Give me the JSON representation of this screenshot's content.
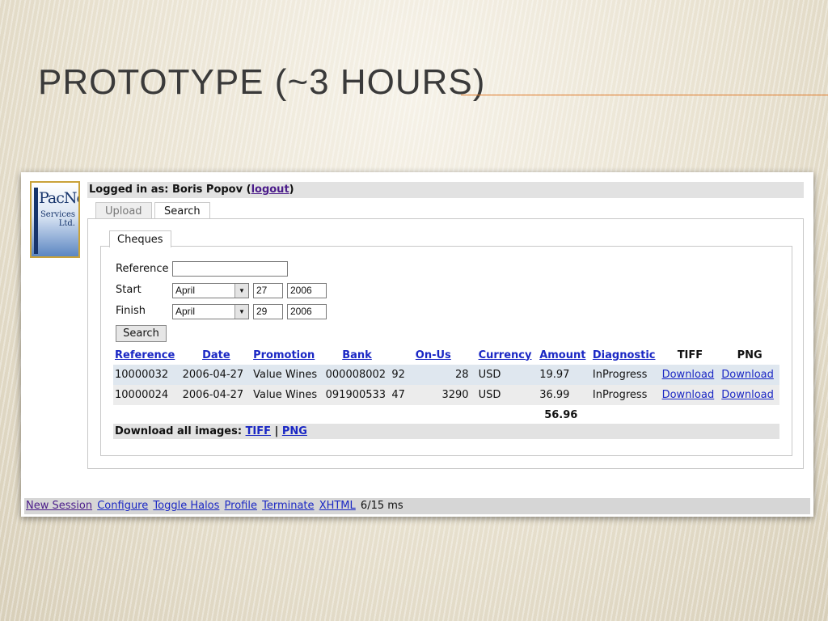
{
  "slide": {
    "title": "Prototype (~3 hours)"
  },
  "app": {
    "logo": {
      "line1": "PacNet",
      "line2": "Services",
      "line3": "Ltd."
    },
    "login": {
      "prefix": "Logged in as: Boris Popov (",
      "logout": "logout",
      "suffix": ")"
    },
    "tabs": [
      {
        "label": "Upload"
      },
      {
        "label": "Search"
      }
    ],
    "subtab": "Cheques",
    "form": {
      "reference_label": "Reference",
      "reference_value": "",
      "start_label": "Start",
      "start_month": "April",
      "start_day": "27",
      "start_year": "2006",
      "finish_label": "Finish",
      "finish_month": "April",
      "finish_day": "29",
      "finish_year": "2006",
      "search_button": "Search"
    },
    "table": {
      "headers": [
        "Reference",
        "Date",
        "Promotion",
        "Bank",
        "On-Us",
        "Currency",
        "Amount",
        "Diagnostic",
        "TIFF",
        "PNG"
      ],
      "rows": [
        {
          "reference": "10000032",
          "date": "2006-04-27",
          "promotion": "Value Wines",
          "bank": "000008002",
          "bank2": "92",
          "onus": "28",
          "currency": "USD",
          "amount": "19.97",
          "diagnostic": "InProgress",
          "tiff": "Download",
          "png": "Download"
        },
        {
          "reference": "10000024",
          "date": "2006-04-27",
          "promotion": "Value Wines",
          "bank": "091900533",
          "bank2": "47",
          "onus": "3290",
          "currency": "USD",
          "amount": "36.99",
          "diagnostic": "InProgress",
          "tiff": "Download",
          "png": "Download"
        }
      ],
      "total": "56.96"
    },
    "download_all": {
      "label": "Download all images:",
      "tiff": "TIFF",
      "sep": "|",
      "png": "PNG"
    },
    "footer": {
      "links": [
        "New Session",
        "Configure",
        "Toggle Halos",
        "Profile",
        "Terminate",
        "XHTML"
      ],
      "timing": "6/15 ms"
    }
  }
}
